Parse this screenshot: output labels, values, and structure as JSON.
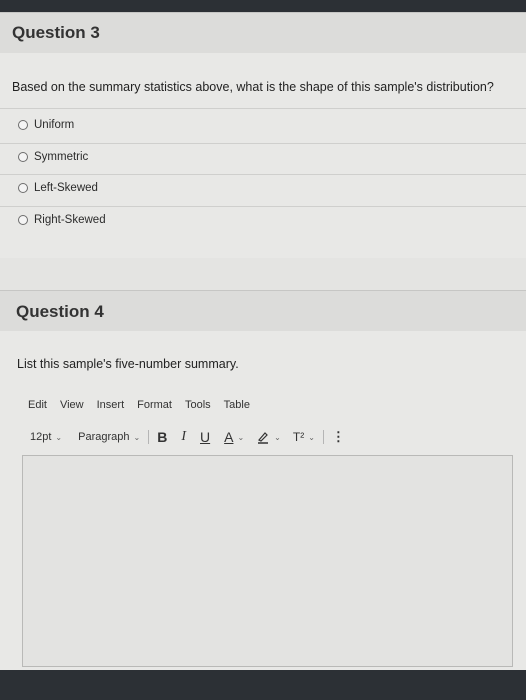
{
  "question3": {
    "title": "Question 3",
    "prompt": "Based on the summary statistics above, what is the shape of this sample's distribution?",
    "options": [
      {
        "label": "Uniform"
      },
      {
        "label": "Symmetric"
      },
      {
        "label": "Left-Skewed"
      },
      {
        "label": "Right-Skewed"
      }
    ]
  },
  "question4": {
    "title": "Question 4",
    "prompt": "List this sample's five-number summary.",
    "editor": {
      "menu": [
        "Edit",
        "View",
        "Insert",
        "Format",
        "Tools",
        "Table"
      ],
      "font_size": "12pt",
      "block_format": "Paragraph",
      "bold": "B",
      "italic": "I",
      "underline": "U",
      "text_color": "A",
      "superscript": "T²",
      "more": "⋮"
    }
  }
}
